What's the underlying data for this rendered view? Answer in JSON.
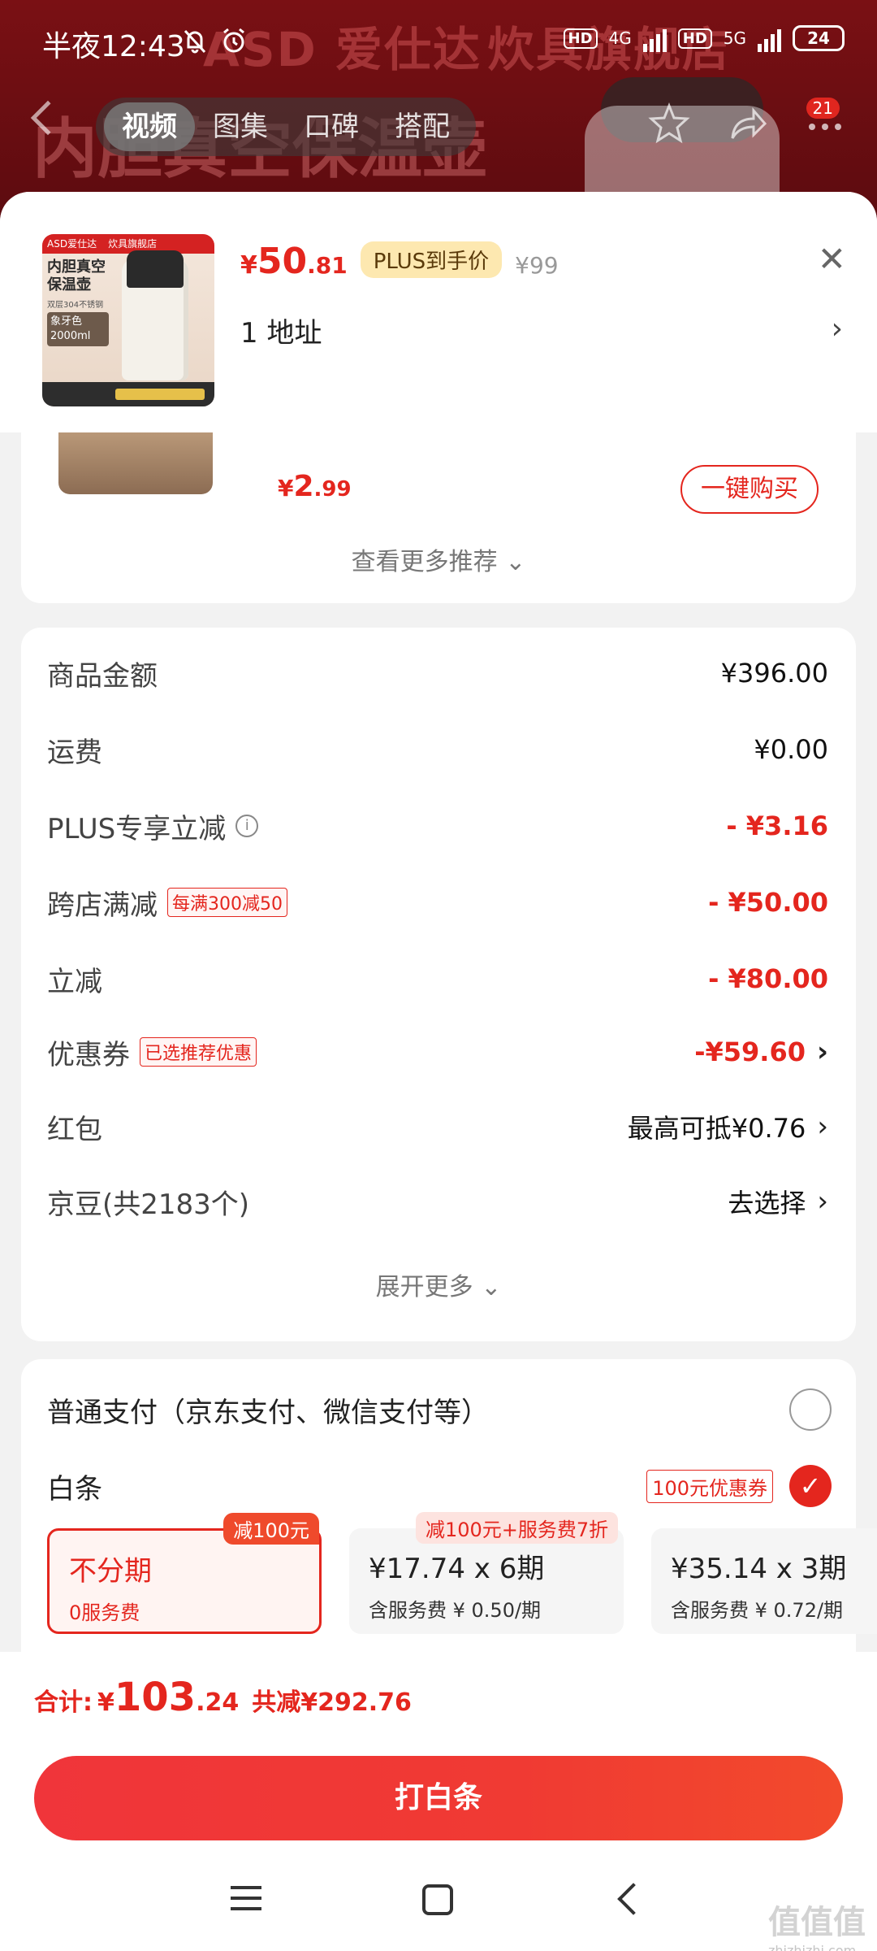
{
  "status_bar": {
    "time": "半夜12:43",
    "network1": "4G",
    "network2": "5G",
    "hd": "HD",
    "battery": "24"
  },
  "top_nav": {
    "tabs": [
      "视频",
      "图集",
      "口碑",
      "搭配"
    ],
    "active_tab": "视频",
    "badge_count": "21"
  },
  "background": {
    "store_logo": "ASD 爱仕达",
    "store_name": "炊具旗舰店",
    "headline": "内胆真空保温壶"
  },
  "product": {
    "thumb_top_left": "ASD爱仕达",
    "thumb_top_right": "炊具旗舰店",
    "thumb_title": "内胆真空保温壶",
    "thumb_sub": "双层304不锈钢",
    "thumb_color": "象牙色 2000ml",
    "price_symbol": "¥",
    "price_int": "50",
    "price_dec": ".81",
    "plus_tag": "PLUS到手价",
    "original_price": "¥99",
    "address": "1  地址"
  },
  "recommend": {
    "price_symbol": "¥",
    "price_int": "2",
    "price_dec": ".99",
    "buy_label": "一键购买",
    "more_label": "查看更多推荐 ⌄"
  },
  "summary": {
    "rows": [
      {
        "label": "商品金额",
        "value": "¥396.00"
      },
      {
        "label": "运费",
        "value": "¥0.00"
      },
      {
        "label": "PLUS专享立减",
        "value": "- ¥3.16"
      },
      {
        "label": "跨店满减",
        "tag": "每满300减50",
        "value": "- ¥50.00"
      },
      {
        "label": "立减",
        "value": "- ¥80.00"
      },
      {
        "label": "优惠券",
        "tag": "已选推荐优惠",
        "value": "-¥59.60"
      },
      {
        "label": "红包",
        "value": "最高可抵¥0.76"
      },
      {
        "label": "京豆(共2183个)",
        "value": "去选择"
      }
    ],
    "expand_label": "展开更多 ⌄"
  },
  "payment": {
    "normal_label": "普通支付（京东支付、微信支付等）",
    "baitiao_label": "白条",
    "baitiao_coupon": "100元优惠券",
    "plans": [
      {
        "main": "不分期",
        "sub": "0服务费",
        "tag": "减100元",
        "selected": true
      },
      {
        "main": "¥17.74 x 6期",
        "sub": "含服务费 ¥ 0.50/期",
        "tag": "减100元+服务费7折"
      },
      {
        "main": "¥35.14 x 3期",
        "sub": "含服务费 ¥ 0.72/期"
      }
    ]
  },
  "bottom": {
    "total_label": "合计:",
    "total_symbol": "¥",
    "total_int": "103",
    "total_dec": ".24",
    "saved": "共减¥292.76",
    "cta_label": "打白条"
  },
  "watermark": {
    "text": "值值值",
    "url": "zhizhizhi.com"
  },
  "colors": {
    "accent": "#e4261e",
    "plus_tag_bg": "#fde8b0",
    "sheet_bg": "#f2f2f2"
  }
}
